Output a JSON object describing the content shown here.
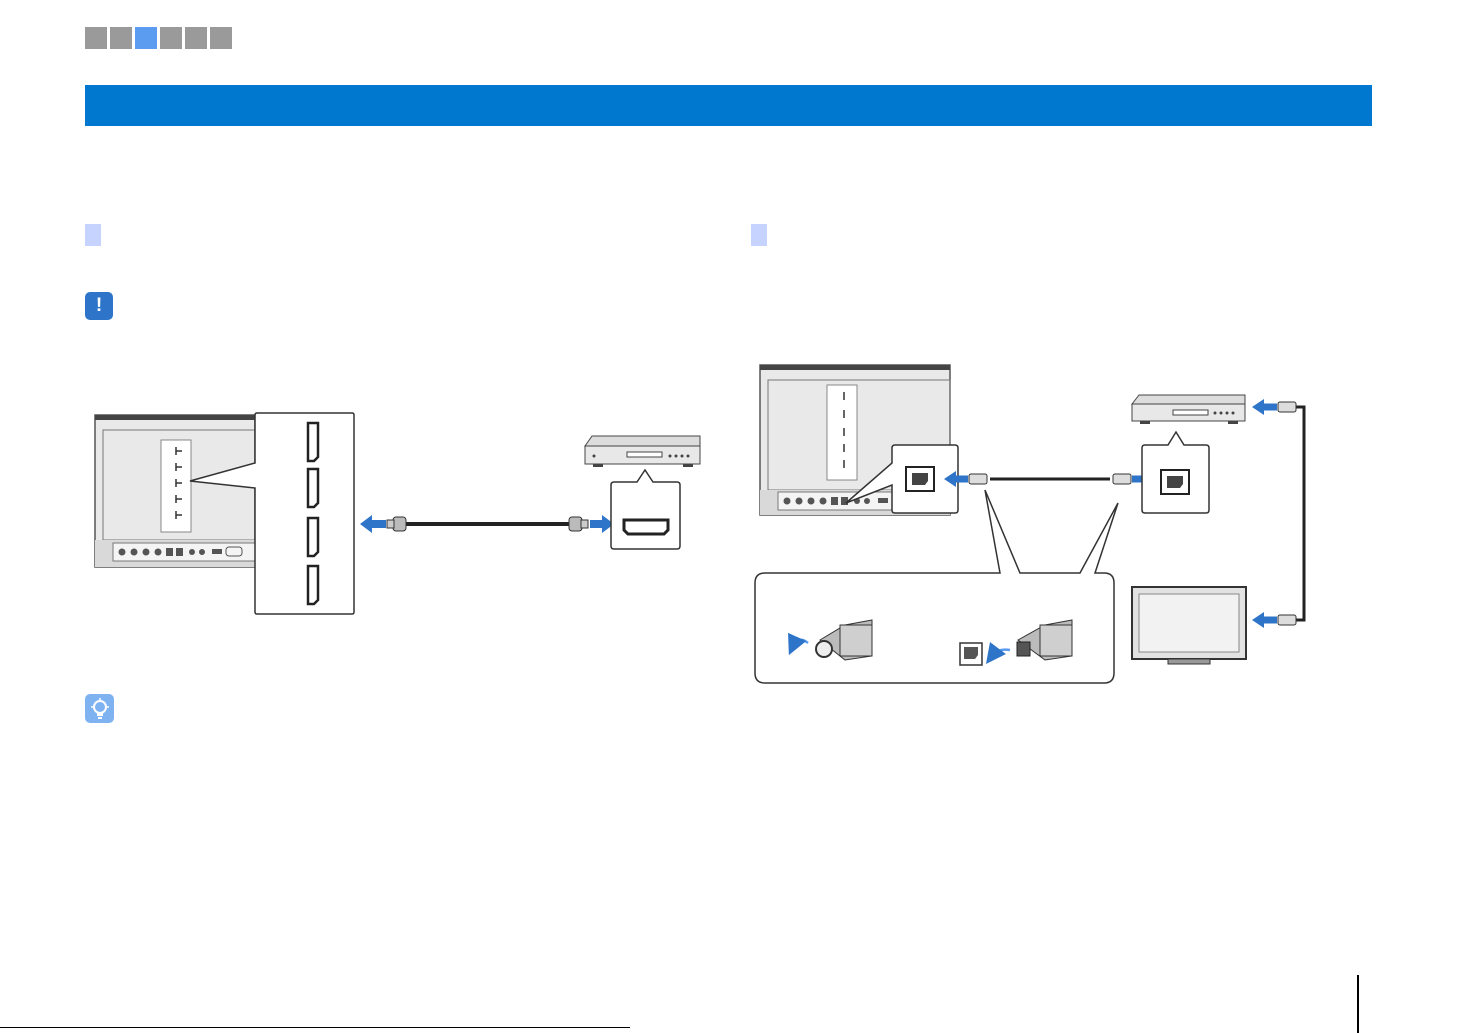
{
  "progress": {
    "steps": 6,
    "active_index": 2
  },
  "banner": {
    "title": ""
  },
  "left_section": {
    "heading": ""
  },
  "right_section": {
    "heading": ""
  },
  "colors": {
    "accent": "#0078d0",
    "step_active": "#5b9bf0",
    "step_idle": "#9a9a9a",
    "marker": "#c6d3ff",
    "arrow": "#2e74c8"
  },
  "icons": [
    "alert-icon",
    "tip-icon",
    "hdmi-port-icon",
    "optical-port-icon",
    "bd-player-icon",
    "tv-icon",
    "cable-icon",
    "arrow-icon"
  ]
}
